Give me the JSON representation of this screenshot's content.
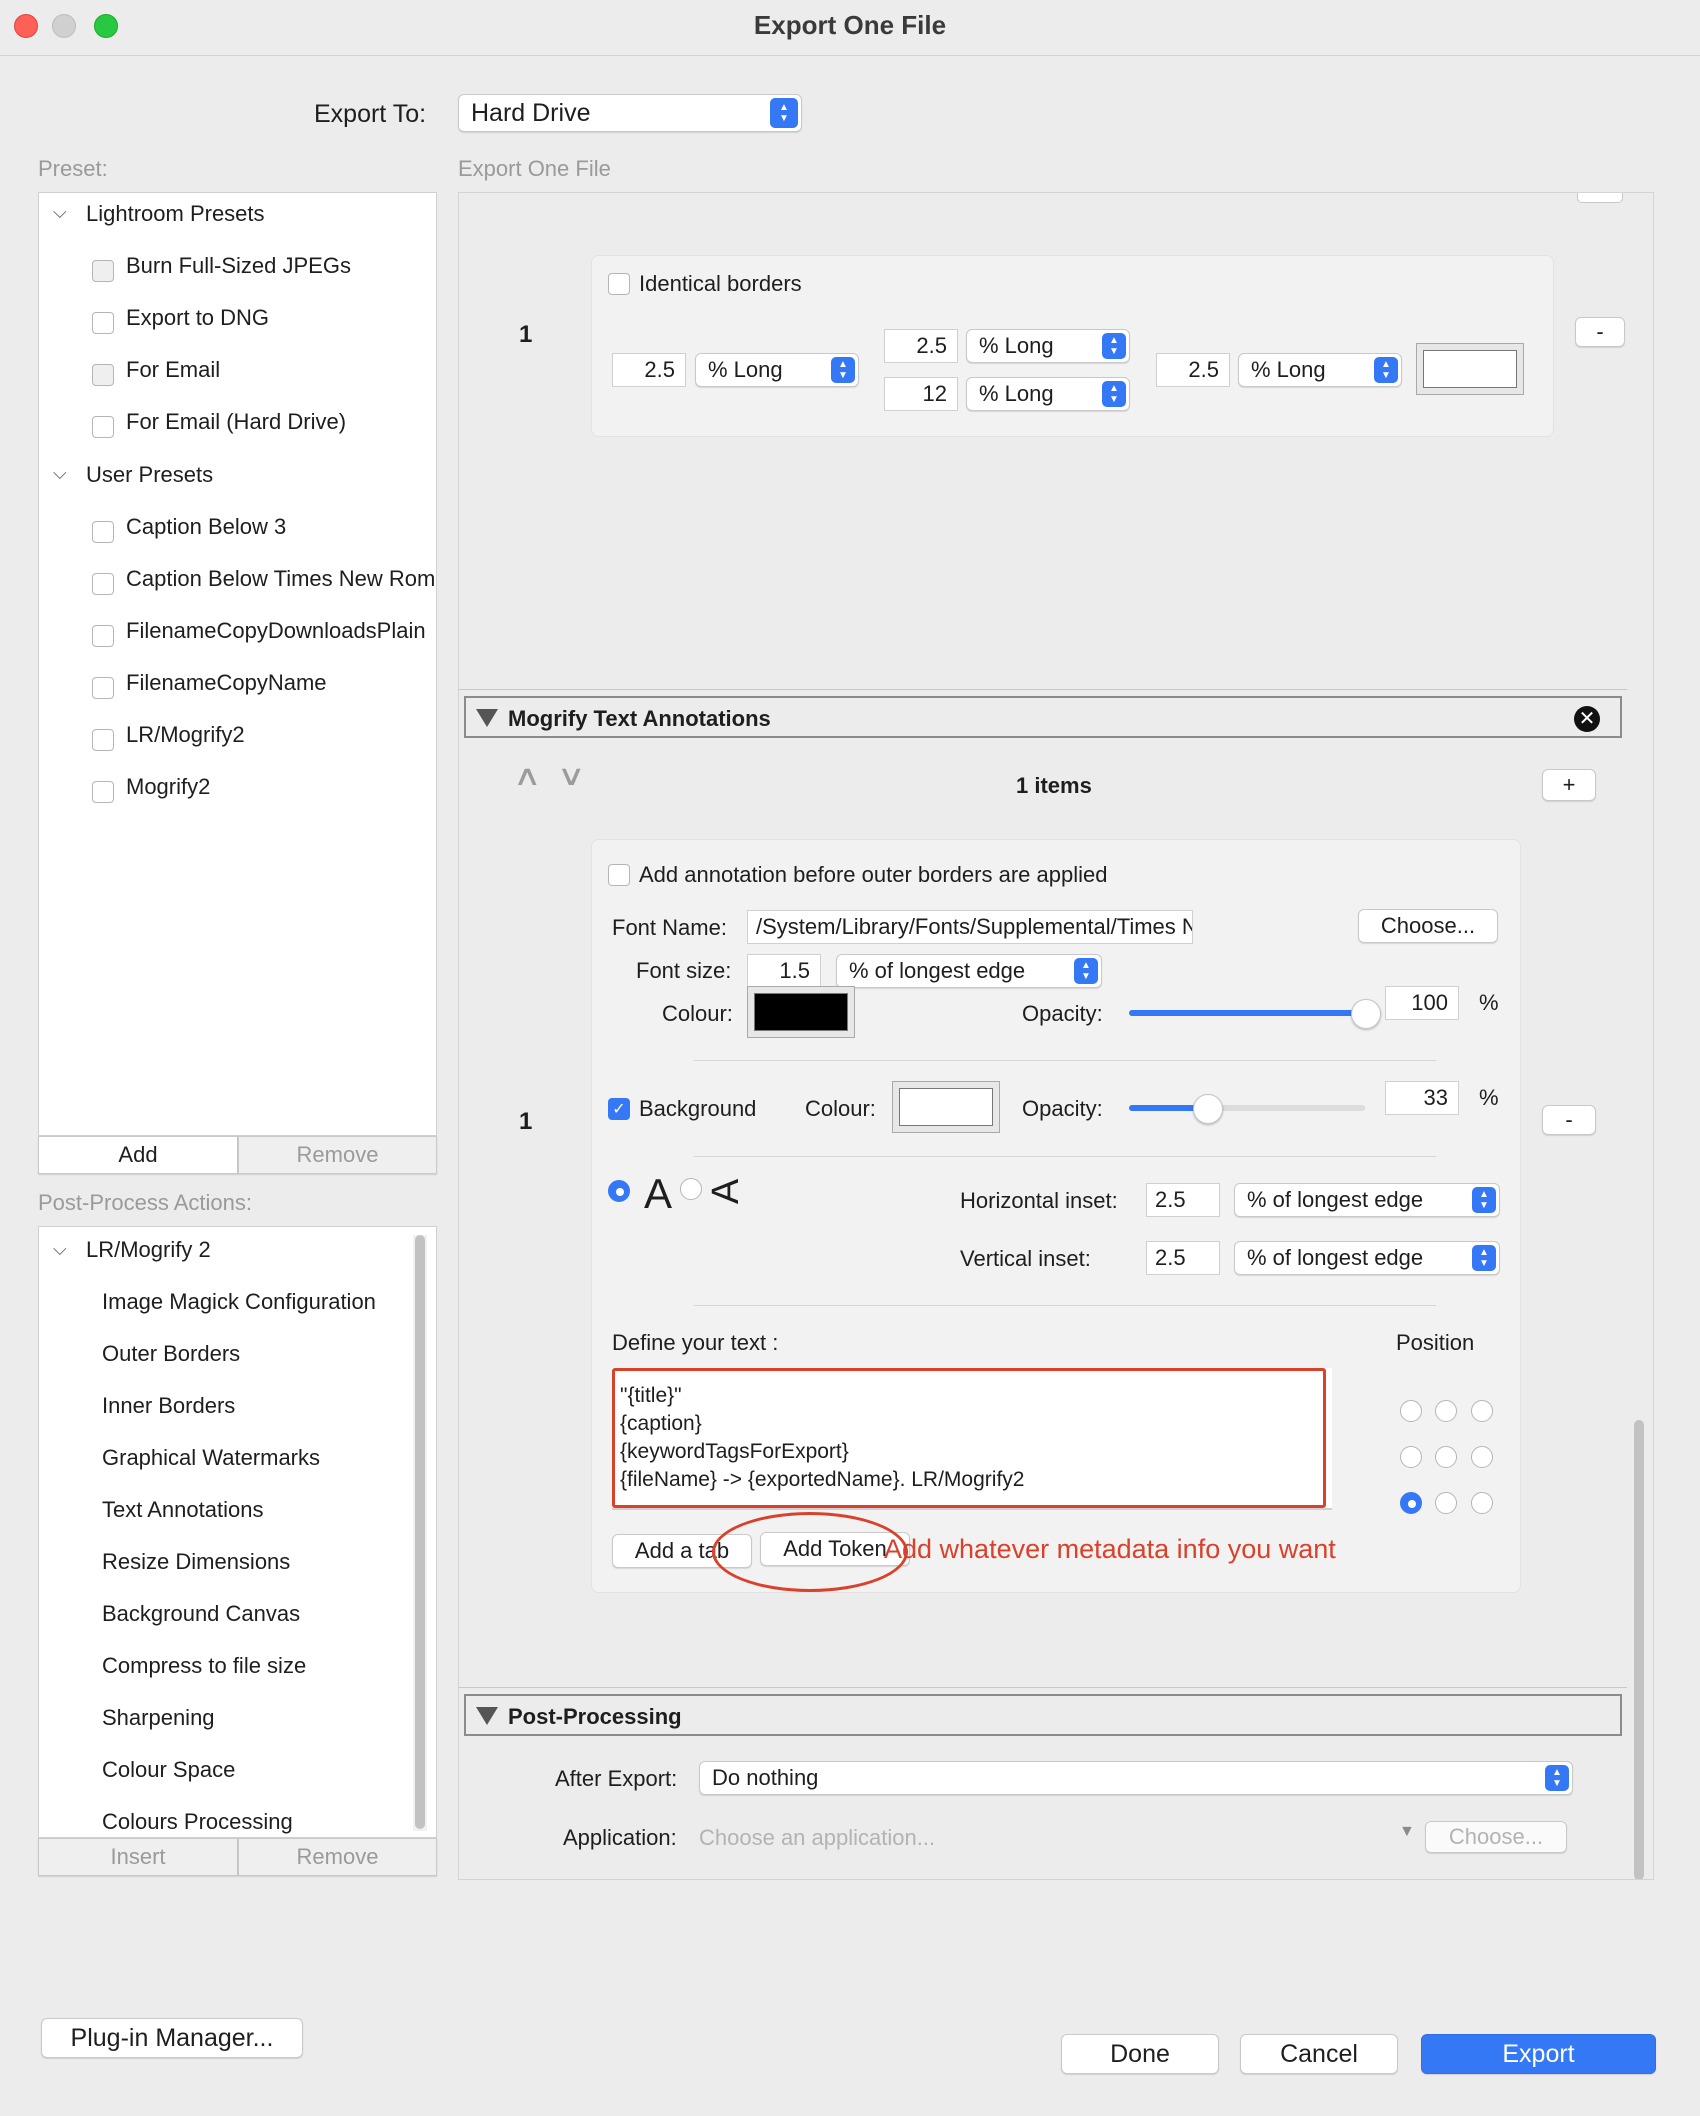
{
  "window": {
    "title": "Export One File"
  },
  "export_to": {
    "label": "Export To:",
    "value": "Hard Drive"
  },
  "preset": {
    "label": "Preset:",
    "groups": [
      {
        "name": "Lightroom Presets",
        "items": [
          "Burn Full-Sized JPEGs",
          "Export to DNG",
          "For Email",
          "For Email (Hard Drive)"
        ]
      },
      {
        "name": "User Presets",
        "items": [
          "Caption Below 3",
          "Caption Below Times New Roman",
          "FilenameCopyDownloadsPlain",
          "FilenameCopyName",
          "LR/Mogrify2",
          "Mogrify2"
        ]
      }
    ],
    "add": "Add",
    "remove": "Remove"
  },
  "post_process": {
    "label": "Post-Process Actions:",
    "group": "LR/Mogrify 2",
    "items": [
      "Image Magick Configuration",
      "Outer Borders",
      "Inner Borders",
      "Graphical Watermarks",
      "Text Annotations",
      "Resize Dimensions",
      "Background Canvas",
      "Compress to file size",
      "Sharpening",
      "Colour Space",
      "Colours Processing"
    ],
    "insert": "Insert",
    "remove": "Remove"
  },
  "main": {
    "label": "Export One File"
  },
  "borders": {
    "row_number": "1",
    "identical_label": "Identical borders",
    "left_value": "2.5",
    "left_unit": "% Long",
    "top_value": "2.5",
    "top_unit": "% Long",
    "bottom_value": "12",
    "bottom_unit": "% Long",
    "right_value": "2.5",
    "right_unit": "% Long",
    "minus": "-"
  },
  "mogrify": {
    "title": "Mogrify Text Annotations",
    "up": "^",
    "down": "v",
    "count": "1 items",
    "plus": "+",
    "minus": "-",
    "row_number": "1",
    "before_label": "Add annotation before outer borders are applied",
    "font_name_label": "Font Name:",
    "font_name_value": "/System/Library/Fonts/Supplemental/Times New",
    "choose": "Choose...",
    "font_size_label": "Font size:",
    "font_size_value": "1.5",
    "font_size_unit": "% of longest edge",
    "colour_label": "Colour:",
    "text_colour": "#000000",
    "opacity_label": "Opacity:",
    "opacity_value": "100",
    "opacity_fraction": 1.0,
    "pct": "%",
    "background_label": "Background",
    "bg_colour_label": "Colour:",
    "bg_opacity_label": "Opacity:",
    "bg_opacity_value": "33",
    "bg_opacity_fraction": 0.33,
    "orient_glyph_a": "A",
    "orient_glyph_b": "A",
    "h_inset_label": "Horizontal inset:",
    "h_inset_value": "2.5",
    "h_inset_unit": "% of longest edge",
    "v_inset_label": "Vertical inset:",
    "v_inset_value": "2.5",
    "v_inset_unit": "% of longest edge",
    "define_label": "Define your text :",
    "position_label": "Position",
    "text_lines": [
      "\"{title}\"",
      "{caption}",
      "{keywordTagsForExport}",
      "{fileName} -> {exportedName}.   LR/Mogrify2"
    ],
    "add_tab": "Add a tab",
    "add_token": "Add Token",
    "annotation_note": "Add whatever metadata info you want"
  },
  "post_processing": {
    "title": "Post-Processing",
    "after_label": "After Export:",
    "after_value": "Do nothing",
    "app_label": "Application:",
    "app_placeholder": "Choose an application...",
    "choose": "Choose..."
  },
  "footer": {
    "plugin_manager": "Plug-in Manager...",
    "done": "Done",
    "cancel": "Cancel",
    "export": "Export"
  },
  "colors": {
    "accent": "#3478f6",
    "annotation": "#d9412b"
  }
}
